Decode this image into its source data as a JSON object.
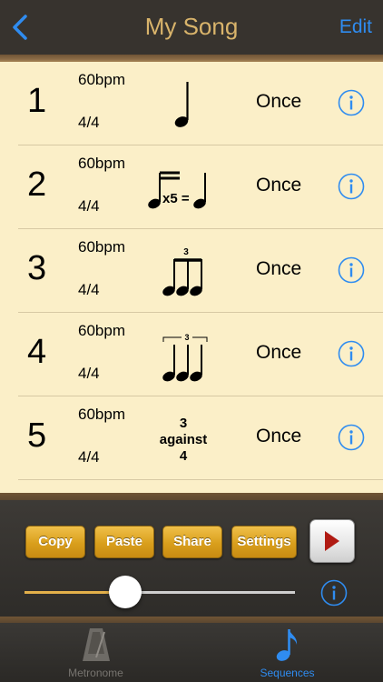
{
  "header": {
    "title": "My Song",
    "edit_label": "Edit"
  },
  "rows": [
    {
      "number": "1",
      "bpm": "60bpm",
      "time_signature": "4/4",
      "pattern": "quarter-note",
      "repeat": "Once"
    },
    {
      "number": "2",
      "bpm": "60bpm",
      "time_signature": "4/4",
      "pattern": "sixteenth-x5-equals-quarter",
      "repeat": "Once",
      "pattern_text": "x5 ="
    },
    {
      "number": "3",
      "bpm": "60bpm",
      "time_signature": "4/4",
      "pattern": "eighth-triplet",
      "repeat": "Once",
      "pattern_text": "3"
    },
    {
      "number": "4",
      "bpm": "60bpm",
      "time_signature": "4/4",
      "pattern": "quarter-triplet-bracket",
      "repeat": "Once",
      "pattern_text": "3"
    },
    {
      "number": "5",
      "bpm": "60bpm",
      "time_signature": "4/4",
      "pattern": "polyrhythm",
      "repeat": "Once",
      "pattern_lines": [
        "3",
        "against",
        "4"
      ]
    }
  ],
  "controls": {
    "copy_label": "Copy",
    "paste_label": "Paste",
    "share_label": "Share",
    "settings_label": "Settings",
    "slider_value": 0.34
  },
  "tabs": [
    {
      "label": "Metronome",
      "icon": "metronome-icon",
      "active": false
    },
    {
      "label": "Sequences",
      "icon": "music-note-icon",
      "active": true
    }
  ],
  "colors": {
    "accent": "#2f8cf0",
    "title": "#d9b46b",
    "button": "#e0a82a",
    "background": "#fbefc8",
    "play": "#b01a12"
  }
}
